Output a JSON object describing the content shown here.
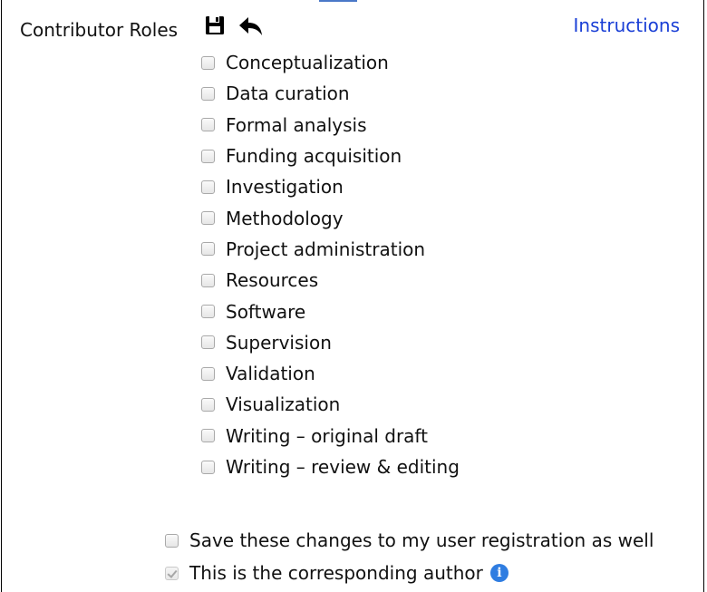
{
  "header": {
    "label": "Contributor Roles",
    "instructions_link": "Instructions",
    "save_icon": "floppy-disk-icon",
    "undo_icon": "reply-arrow-icon"
  },
  "roles": [
    {
      "label": "Conceptualization",
      "checked": false
    },
    {
      "label": "Data curation",
      "checked": false
    },
    {
      "label": "Formal analysis",
      "checked": false
    },
    {
      "label": "Funding acquisition",
      "checked": false
    },
    {
      "label": "Investigation",
      "checked": false
    },
    {
      "label": "Methodology",
      "checked": false
    },
    {
      "label": "Project administration",
      "checked": false
    },
    {
      "label": "Resources",
      "checked": false
    },
    {
      "label": "Software",
      "checked": false
    },
    {
      "label": "Supervision",
      "checked": false
    },
    {
      "label": "Validation",
      "checked": false
    },
    {
      "label": "Visualization",
      "checked": false
    },
    {
      "label": "Writing – original draft",
      "checked": false
    },
    {
      "label": "Writing – review & editing",
      "checked": false
    }
  ],
  "options": {
    "save_registration": {
      "label": "Save these changes to my user registration as well",
      "checked": false
    },
    "corresponding_author": {
      "label": "This is the corresponding author",
      "checked": true,
      "disabled": true
    }
  },
  "colors": {
    "link": "#1a3fd6",
    "info_icon": "#2f7de1"
  }
}
